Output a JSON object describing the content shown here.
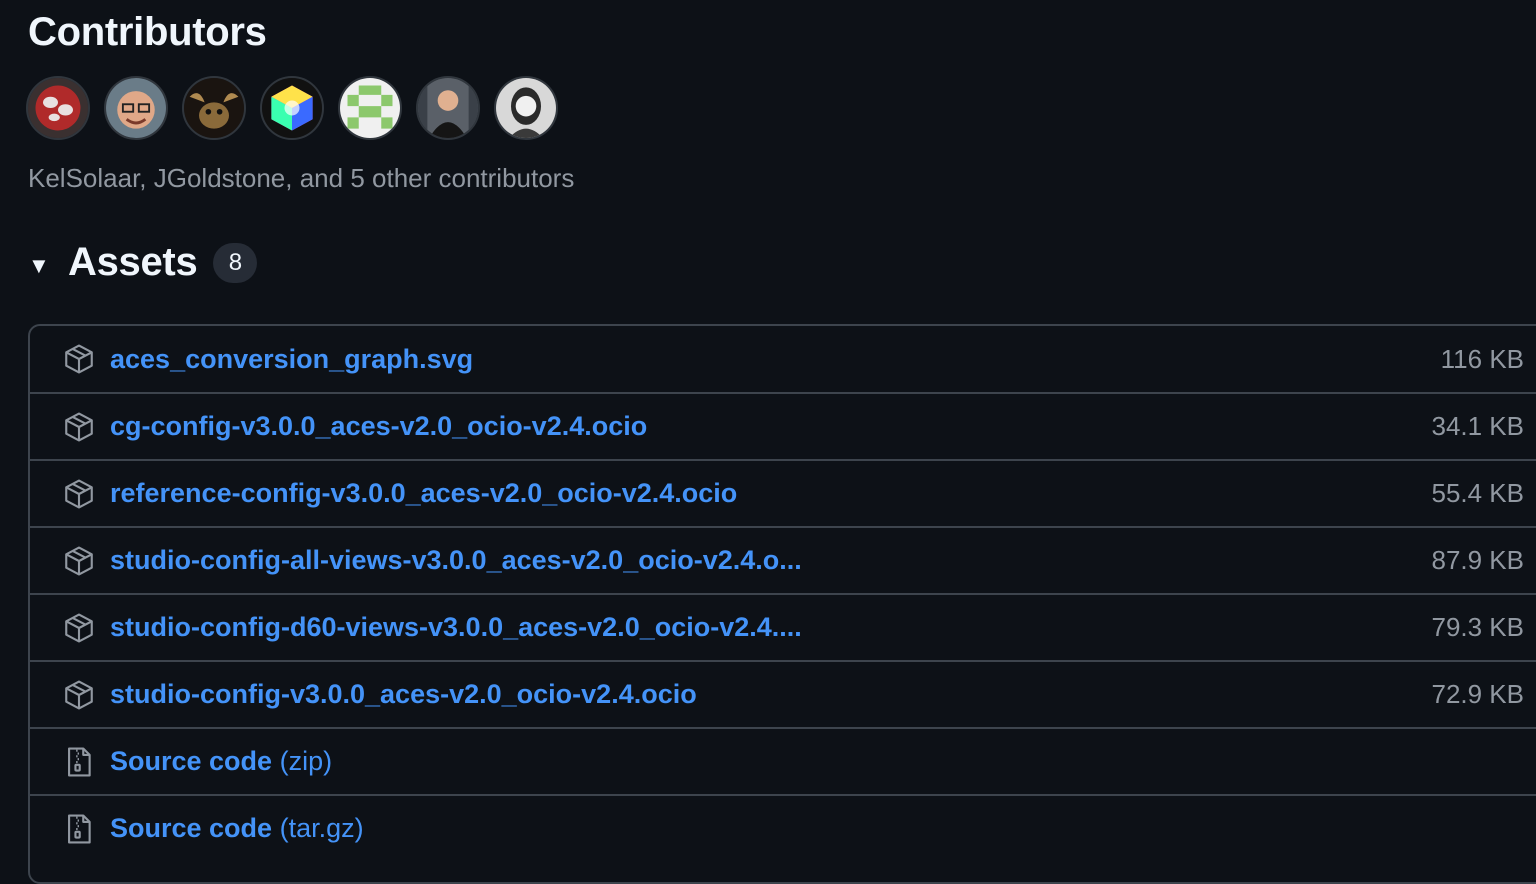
{
  "contributors": {
    "title": "Contributors",
    "avatars": [
      "KelSolaar",
      "JGoldstone",
      "contributor-3",
      "contributor-4",
      "contributor-5",
      "contributor-6",
      "contributor-7"
    ],
    "summary": "KelSolaar, JGoldstone, and 5 other contributors"
  },
  "assets": {
    "title": "Assets",
    "count": "8",
    "caret": "▼",
    "items": [
      {
        "name": "aces_conversion_graph.svg",
        "size": "116 KB",
        "icon": "package-icon"
      },
      {
        "name": "cg-config-v3.0.0_aces-v2.0_ocio-v2.4.ocio",
        "size": "34.1 KB",
        "icon": "package-icon"
      },
      {
        "name": "reference-config-v3.0.0_aces-v2.0_ocio-v2.4.ocio",
        "size": "55.4 KB",
        "icon": "package-icon"
      },
      {
        "name": "studio-config-all-views-v3.0.0_aces-v2.0_ocio-v2.4.o...",
        "size": "87.9 KB",
        "icon": "package-icon"
      },
      {
        "name": "studio-config-d60-views-v3.0.0_aces-v2.0_ocio-v2.4....",
        "size": "79.3 KB",
        "icon": "package-icon"
      },
      {
        "name": "studio-config-v3.0.0_aces-v2.0_ocio-v2.4.ocio",
        "size": "72.9 KB",
        "icon": "package-icon"
      },
      {
        "name": "Source code",
        "suffix": "(zip)",
        "size": "",
        "icon": "file-zip-icon"
      },
      {
        "name": "Source code",
        "suffix": "(tar.gz)",
        "size": "",
        "icon": "file-zip-icon"
      }
    ]
  },
  "colors": {
    "background": "#0d1117",
    "link": "#4493f8",
    "muted": "#9198a1",
    "border": "#3d444d"
  }
}
